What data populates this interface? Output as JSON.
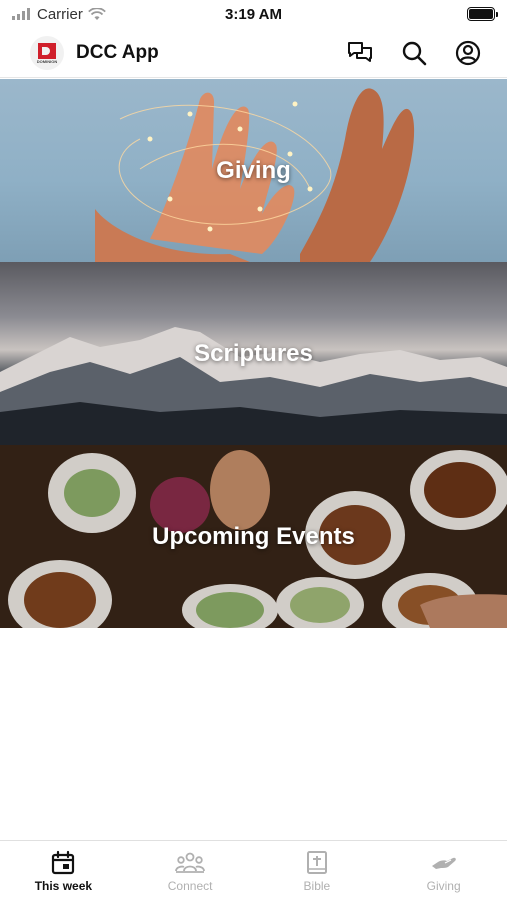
{
  "status_bar": {
    "carrier": "Carrier",
    "time": "3:19 AM"
  },
  "header": {
    "app_name": "DCC App",
    "logo_text": "DOMINION",
    "icons": [
      "chat-icon",
      "search-icon",
      "profile-icon"
    ]
  },
  "tiles": [
    {
      "title": "Giving"
    },
    {
      "title": "Scriptures"
    },
    {
      "title": "Upcoming Events"
    }
  ],
  "tab_bar": {
    "tabs": [
      {
        "label": "This week",
        "icon": "calendar-icon",
        "active": true
      },
      {
        "label": "Connect",
        "icon": "people-icon",
        "active": false
      },
      {
        "label": "Bible",
        "icon": "bible-icon",
        "active": false
      },
      {
        "label": "Giving",
        "icon": "giving-hand-icon",
        "active": false
      }
    ]
  },
  "colors": {
    "active_tab": "#111111",
    "inactive_tab": "#b0b0b0",
    "brand_red": "#d01f2b"
  }
}
